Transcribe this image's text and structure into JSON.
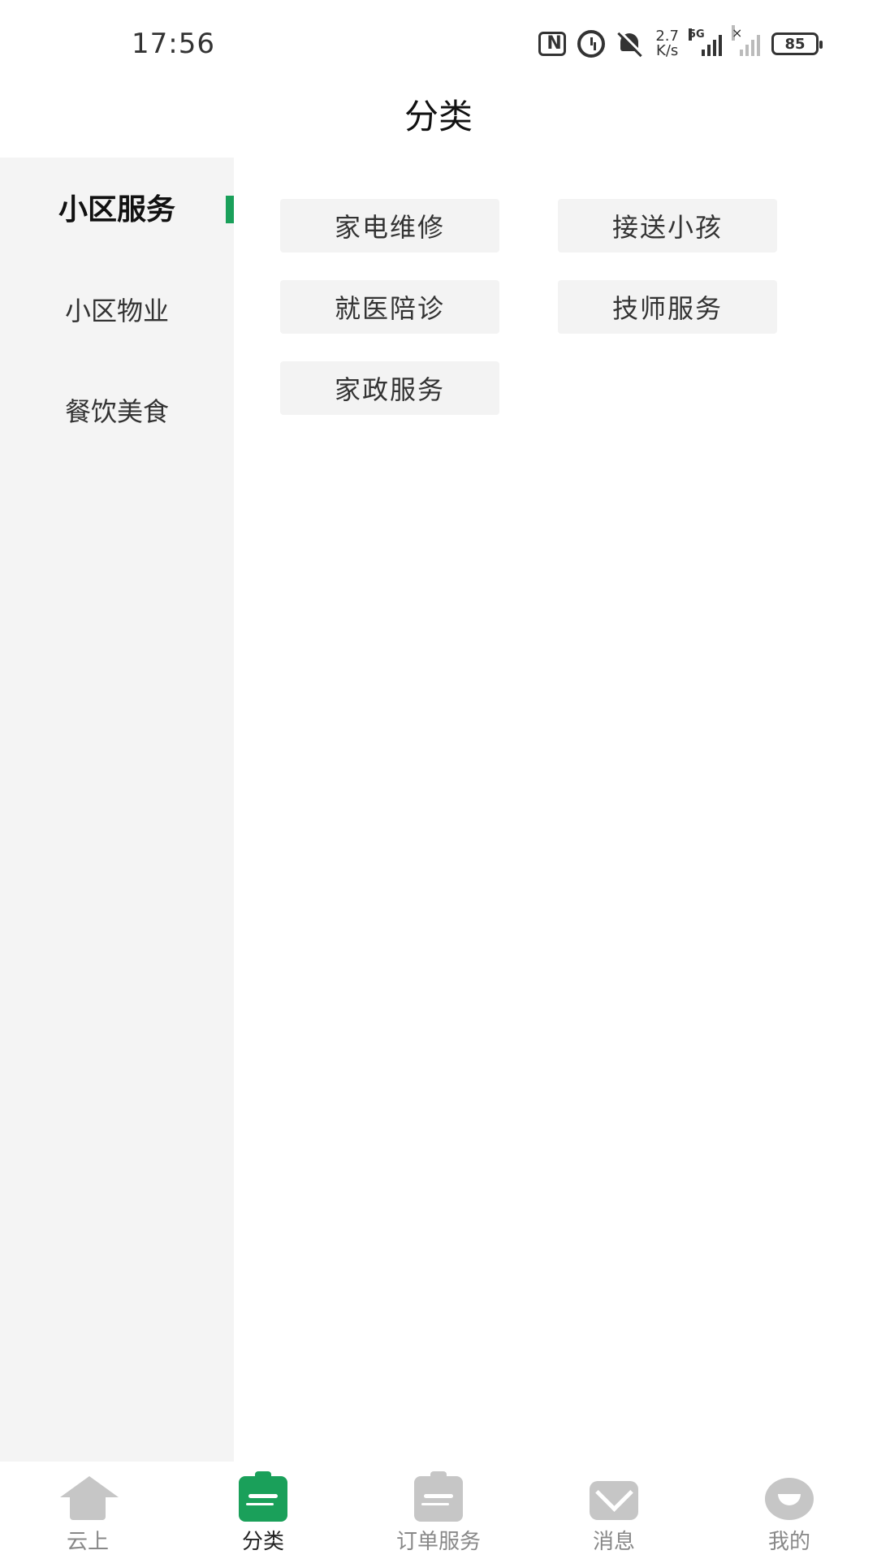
{
  "status_bar": {
    "time": "17:56",
    "net_speed_value": "2.7",
    "net_speed_unit": "K/s",
    "network_type": "5G",
    "battery_level": "85",
    "icons": [
      "nfc-icon",
      "alarm-icon",
      "mute-icon",
      "signal-icon",
      "signal-icon",
      "battery-icon"
    ]
  },
  "header": {
    "title": "分类"
  },
  "sidebar": {
    "items": [
      {
        "label": "小区服务",
        "active": true
      },
      {
        "label": "小区物业",
        "active": false
      },
      {
        "label": "餐饮美食",
        "active": false
      }
    ],
    "accent_color": "#1aa05a"
  },
  "categories": [
    {
      "label": "家电维修"
    },
    {
      "label": "接送小孩"
    },
    {
      "label": "就医陪诊"
    },
    {
      "label": "技师服务"
    },
    {
      "label": "家政服务"
    }
  ],
  "tabbar": {
    "items": [
      {
        "label": "云上",
        "icon": "home-icon",
        "active": false
      },
      {
        "label": "分类",
        "icon": "category-icon",
        "active": true
      },
      {
        "label": "订单服务",
        "icon": "order-icon",
        "active": false
      },
      {
        "label": "消息",
        "icon": "message-icon",
        "active": false
      },
      {
        "label": "我的",
        "icon": "profile-icon",
        "active": false
      }
    ],
    "active_color": "#1aa05a"
  }
}
